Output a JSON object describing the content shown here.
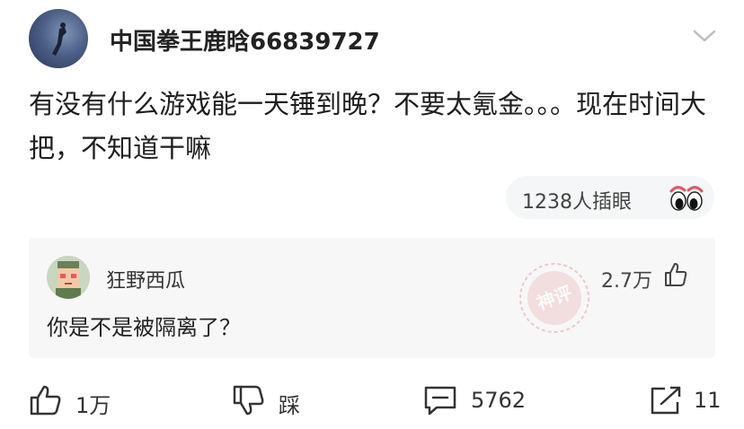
{
  "post": {
    "author": "中国拳王鹿晗66839727",
    "text": "有没有什么游戏能一天锤到晚？不要太氪金。。。现在时间大把，不知道干嘛",
    "reactions": {
      "label": "1238人插眼",
      "icon": "eyes-emoji-icon"
    }
  },
  "top_comment": {
    "author": "狂野西瓜",
    "text": "你是不是被隔离了？",
    "likes": "2.7万",
    "stamp_text": "神评",
    "stamp_color": "#e8a0a6"
  },
  "actions": {
    "like": "1万",
    "dislike": "踩",
    "comments": "5762",
    "share": "11"
  }
}
